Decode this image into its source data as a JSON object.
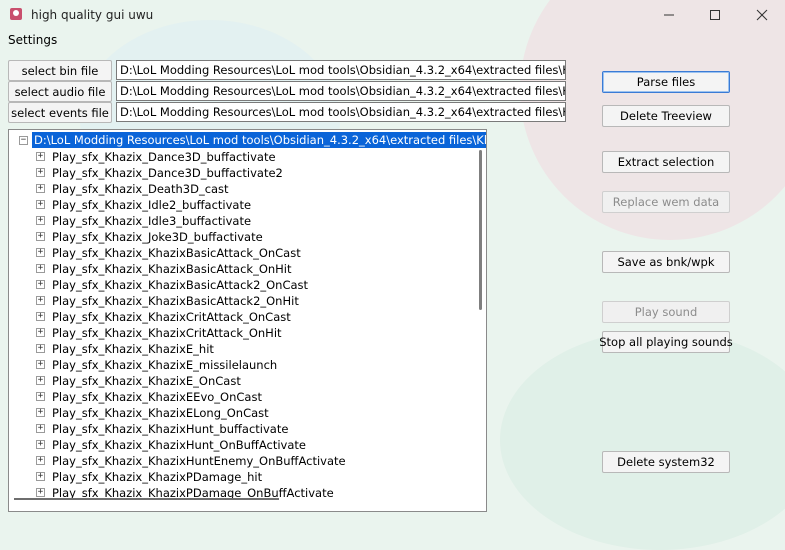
{
  "window": {
    "title": "high quality gui uwu"
  },
  "menu": {
    "settings": "Settings"
  },
  "file_selectors": [
    {
      "button": "select bin file",
      "path": "D:\\LoL Modding Resources\\LoL mod tools\\Obsidian_4.3.2_x64\\extracted files\\Khazix\\data\\cl"
    },
    {
      "button": "select audio file",
      "path": "D:\\LoL Modding Resources\\LoL mod tools\\Obsidian_4.3.2_x64\\extracted files\\Khazix\\assets\\"
    },
    {
      "button": "select events file",
      "path": "D:\\LoL Modding Resources\\LoL mod tools\\Obsidian_4.3.2_x64\\extracted files\\Khazix\\assets\\"
    }
  ],
  "actions": {
    "parse_files": "Parse files",
    "delete_treeview": "Delete Treeview",
    "extract_selection": "Extract selection",
    "replace_wem": "Replace wem data",
    "save_bnk": "Save as bnk/wpk",
    "play_sound": "Play sound",
    "stop_sounds": "Stop all playing sounds",
    "delete_system32": "Delete system32"
  },
  "tree": {
    "root": "D:\\LoL Modding Resources\\LoL mod tools\\Obsidian_4.3.2_x64\\extracted files\\Khazix\\asse",
    "items": [
      "Play_sfx_Khazix_Dance3D_buffactivate",
      "Play_sfx_Khazix_Dance3D_buffactivate2",
      "Play_sfx_Khazix_Death3D_cast",
      "Play_sfx_Khazix_Idle2_buffactivate",
      "Play_sfx_Khazix_Idle3_buffactivate",
      "Play_sfx_Khazix_Joke3D_buffactivate",
      "Play_sfx_Khazix_KhazixBasicAttack_OnCast",
      "Play_sfx_Khazix_KhazixBasicAttack_OnHit",
      "Play_sfx_Khazix_KhazixBasicAttack2_OnCast",
      "Play_sfx_Khazix_KhazixBasicAttack2_OnHit",
      "Play_sfx_Khazix_KhazixCritAttack_OnCast",
      "Play_sfx_Khazix_KhazixCritAttack_OnHit",
      "Play_sfx_Khazix_KhazixE_hit",
      "Play_sfx_Khazix_KhazixE_missilelaunch",
      "Play_sfx_Khazix_KhazixE_OnCast",
      "Play_sfx_Khazix_KhazixEEvo_OnCast",
      "Play_sfx_Khazix_KhazixELong_OnCast",
      "Play_sfx_Khazix_KhazixHunt_buffactivate",
      "Play_sfx_Khazix_KhazixHunt_OnBuffActivate",
      "Play_sfx_Khazix_KhazixHuntEnemy_OnBuffActivate",
      "Play_sfx_Khazix_KhazixPDamage_hit",
      "Play_sfx_Khazix_KhazixPDamage_OnBuffActivate"
    ]
  }
}
